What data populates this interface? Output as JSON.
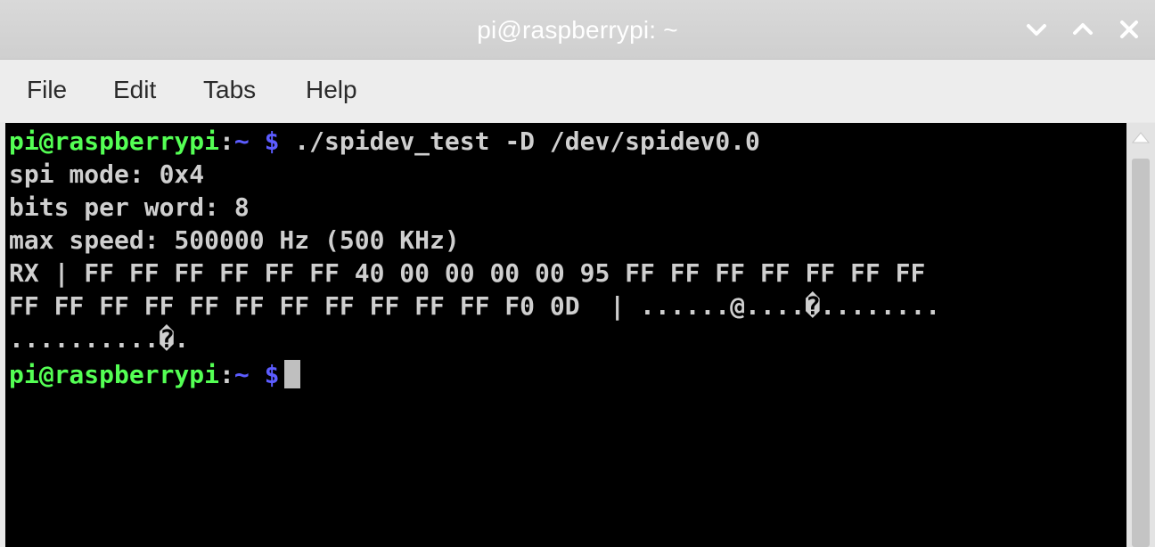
{
  "window": {
    "title": "pi@raspberrypi: ~"
  },
  "menu": {
    "file": "File",
    "edit": "Edit",
    "tabs": "Tabs",
    "help": "Help"
  },
  "terminal": {
    "prompt_user": "pi@raspberrypi",
    "prompt_sep": ":",
    "prompt_path": "~",
    "prompt_dollar": "$",
    "command": " ./spidev_test -D /dev/spidev0.0",
    "output": [
      "spi mode: 0x4",
      "bits per word: 8",
      "max speed: 500000 Hz (500 KHz)",
      "RX | FF FF FF FF FF FF 40 00 00 00 00 95 FF FF FF FF FF FF FF",
      "FF FF FF FF FF FF FF FF FF FF FF F0 0D  | ......@....�........",
      "..........�."
    ]
  },
  "icons": {
    "minimize": "chevron-down-icon",
    "maximize": "chevron-up-icon",
    "close": "close-icon",
    "scroll_up": "triangle-up-icon"
  },
  "colors": {
    "prompt_user": "#54ff54",
    "prompt_path": "#5c5cff",
    "terminal_bg": "#000000",
    "terminal_fg": "#cfcfcf"
  }
}
